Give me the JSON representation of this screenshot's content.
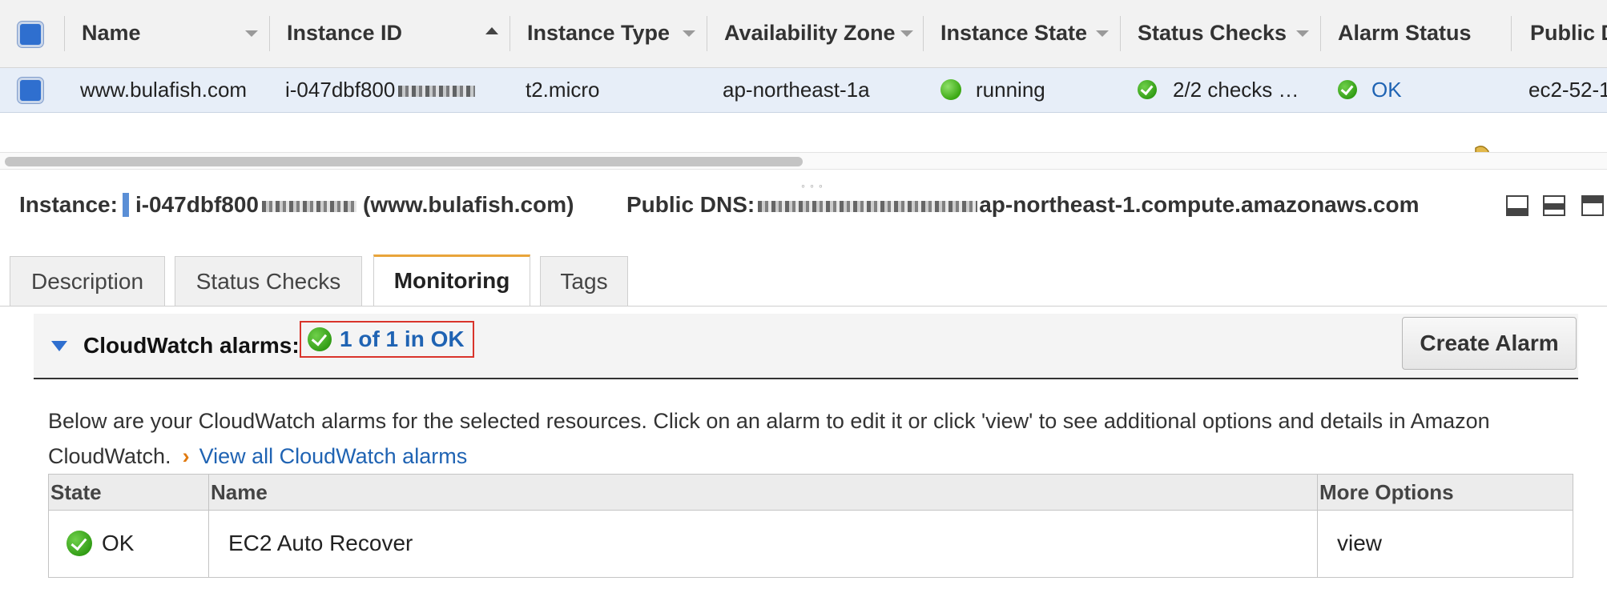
{
  "instances_table": {
    "columns": [
      "Name",
      "Instance ID",
      "Instance Type",
      "Availability Zone",
      "Instance State",
      "Status Checks",
      "Alarm Status",
      "Public D"
    ],
    "row": {
      "name": "www.bulafish.com",
      "instance_id": "i-047dbf800",
      "instance_type": "t2.micro",
      "availability_zone": "ap-northeast-1a",
      "instance_state": "running",
      "status_checks": "2/2 checks …",
      "alarm_status": "OK",
      "public_dns": "ec2-52-1"
    }
  },
  "instance_info": {
    "instance_label": "Instance:",
    "instance_id": "i-047dbf800",
    "instance_name": "(www.bulafish.com)",
    "public_dns_label": "Public DNS:",
    "public_dns_suffix": "ap-northeast-1.compute.amazonaws.com"
  },
  "tabs": [
    {
      "label": "Description",
      "active": false
    },
    {
      "label": "Status Checks",
      "active": false
    },
    {
      "label": "Monitoring",
      "active": true
    },
    {
      "label": "Tags",
      "active": false
    }
  ],
  "cloudwatch": {
    "title": "CloudWatch alarms:",
    "summary": "1 of 1 in OK",
    "create_button": "Create Alarm",
    "description": "Below are your CloudWatch alarms for the selected resources. Click on an alarm to edit it or click 'view' to see additional options and details in Amazon CloudWatch.",
    "view_all_link": "View all CloudWatch alarms"
  },
  "alarms_table": {
    "headers": {
      "state": "State",
      "name": "Name",
      "more": "More Options"
    },
    "rows": [
      {
        "state": "OK",
        "name": "EC2 Auto Recover",
        "action": "view"
      }
    ]
  },
  "colors": {
    "link": "#1f63b3",
    "accent_tab": "#e9a43a",
    "highlight_box": "#d9342b",
    "selected_row": "#e7eef8"
  }
}
